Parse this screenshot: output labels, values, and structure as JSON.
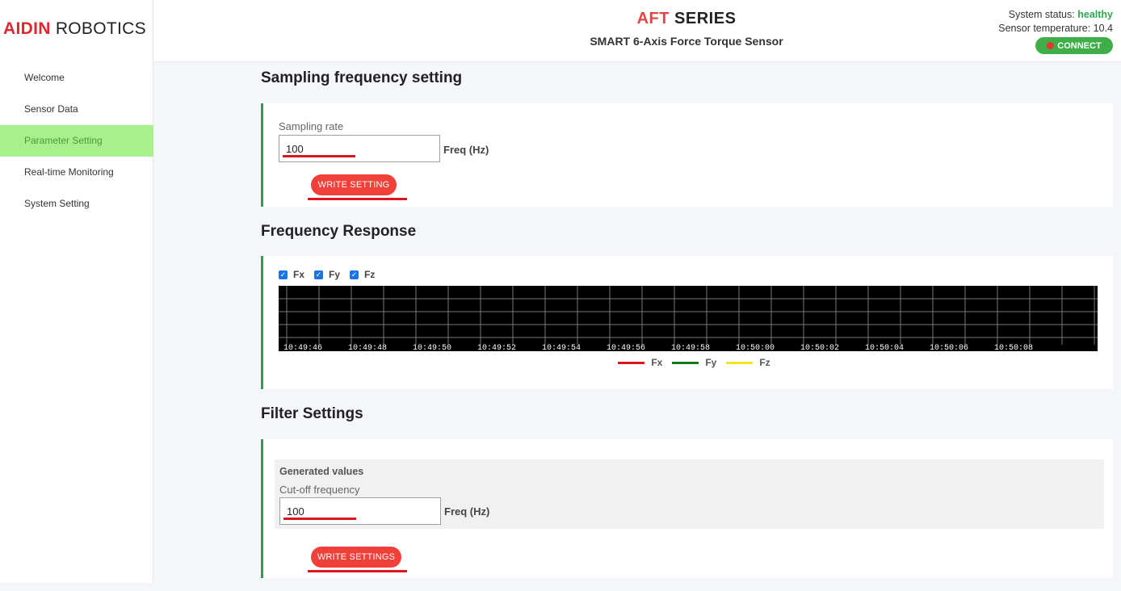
{
  "brand": {
    "part1": "AIDIN",
    "part2": "ROBOTICS"
  },
  "header": {
    "title_accent": "AFT",
    "title_rest": "SERIES",
    "subtitle": "SMART 6-Axis Force Torque Sensor",
    "status_label": "System status:",
    "status_value": "healthy",
    "temperature": "Sensor temperature: 10.4",
    "connect_label": "CONNECT"
  },
  "sidebar": {
    "items": [
      {
        "label": "Welcome"
      },
      {
        "label": "Sensor Data"
      },
      {
        "label": "Parameter Setting"
      },
      {
        "label": "Real-time Monitoring"
      },
      {
        "label": "System Setting"
      }
    ]
  },
  "sampling": {
    "title": "Sampling frequency setting",
    "label": "Sampling rate",
    "value": "100",
    "unit": "Freq (Hz)",
    "button": "WRITE SETTING"
  },
  "frequency": {
    "title": "Frequency Response",
    "checkboxes": [
      {
        "label": "Fx",
        "checked": true
      },
      {
        "label": "Fy",
        "checked": true
      },
      {
        "label": "Fz",
        "checked": true
      }
    ]
  },
  "chart_data": {
    "type": "line",
    "title": "",
    "xlabel": "",
    "ylabel": "",
    "x": [
      "10:49:46",
      "10:49:48",
      "10:49:50",
      "10:49:52",
      "10:49:54",
      "10:49:56",
      "10:49:58",
      "10:50:00",
      "10:50:02",
      "10:50:04",
      "10:50:06",
      "10:50:08"
    ],
    "series": [
      {
        "name": "Fx",
        "color": "#e0161e",
        "values": []
      },
      {
        "name": "Fy",
        "color": "#1a7a1a",
        "values": []
      },
      {
        "name": "Fz",
        "color": "#f5e61c",
        "values": []
      }
    ],
    "grid": true,
    "legend": "bottom",
    "background": "#000000"
  },
  "filter": {
    "title": "Filter Settings",
    "panel_title": "Generated values",
    "label": "Cut-off frequency",
    "value": "100",
    "unit": "Freq (Hz)",
    "button": "WRITE SETTINGS"
  }
}
